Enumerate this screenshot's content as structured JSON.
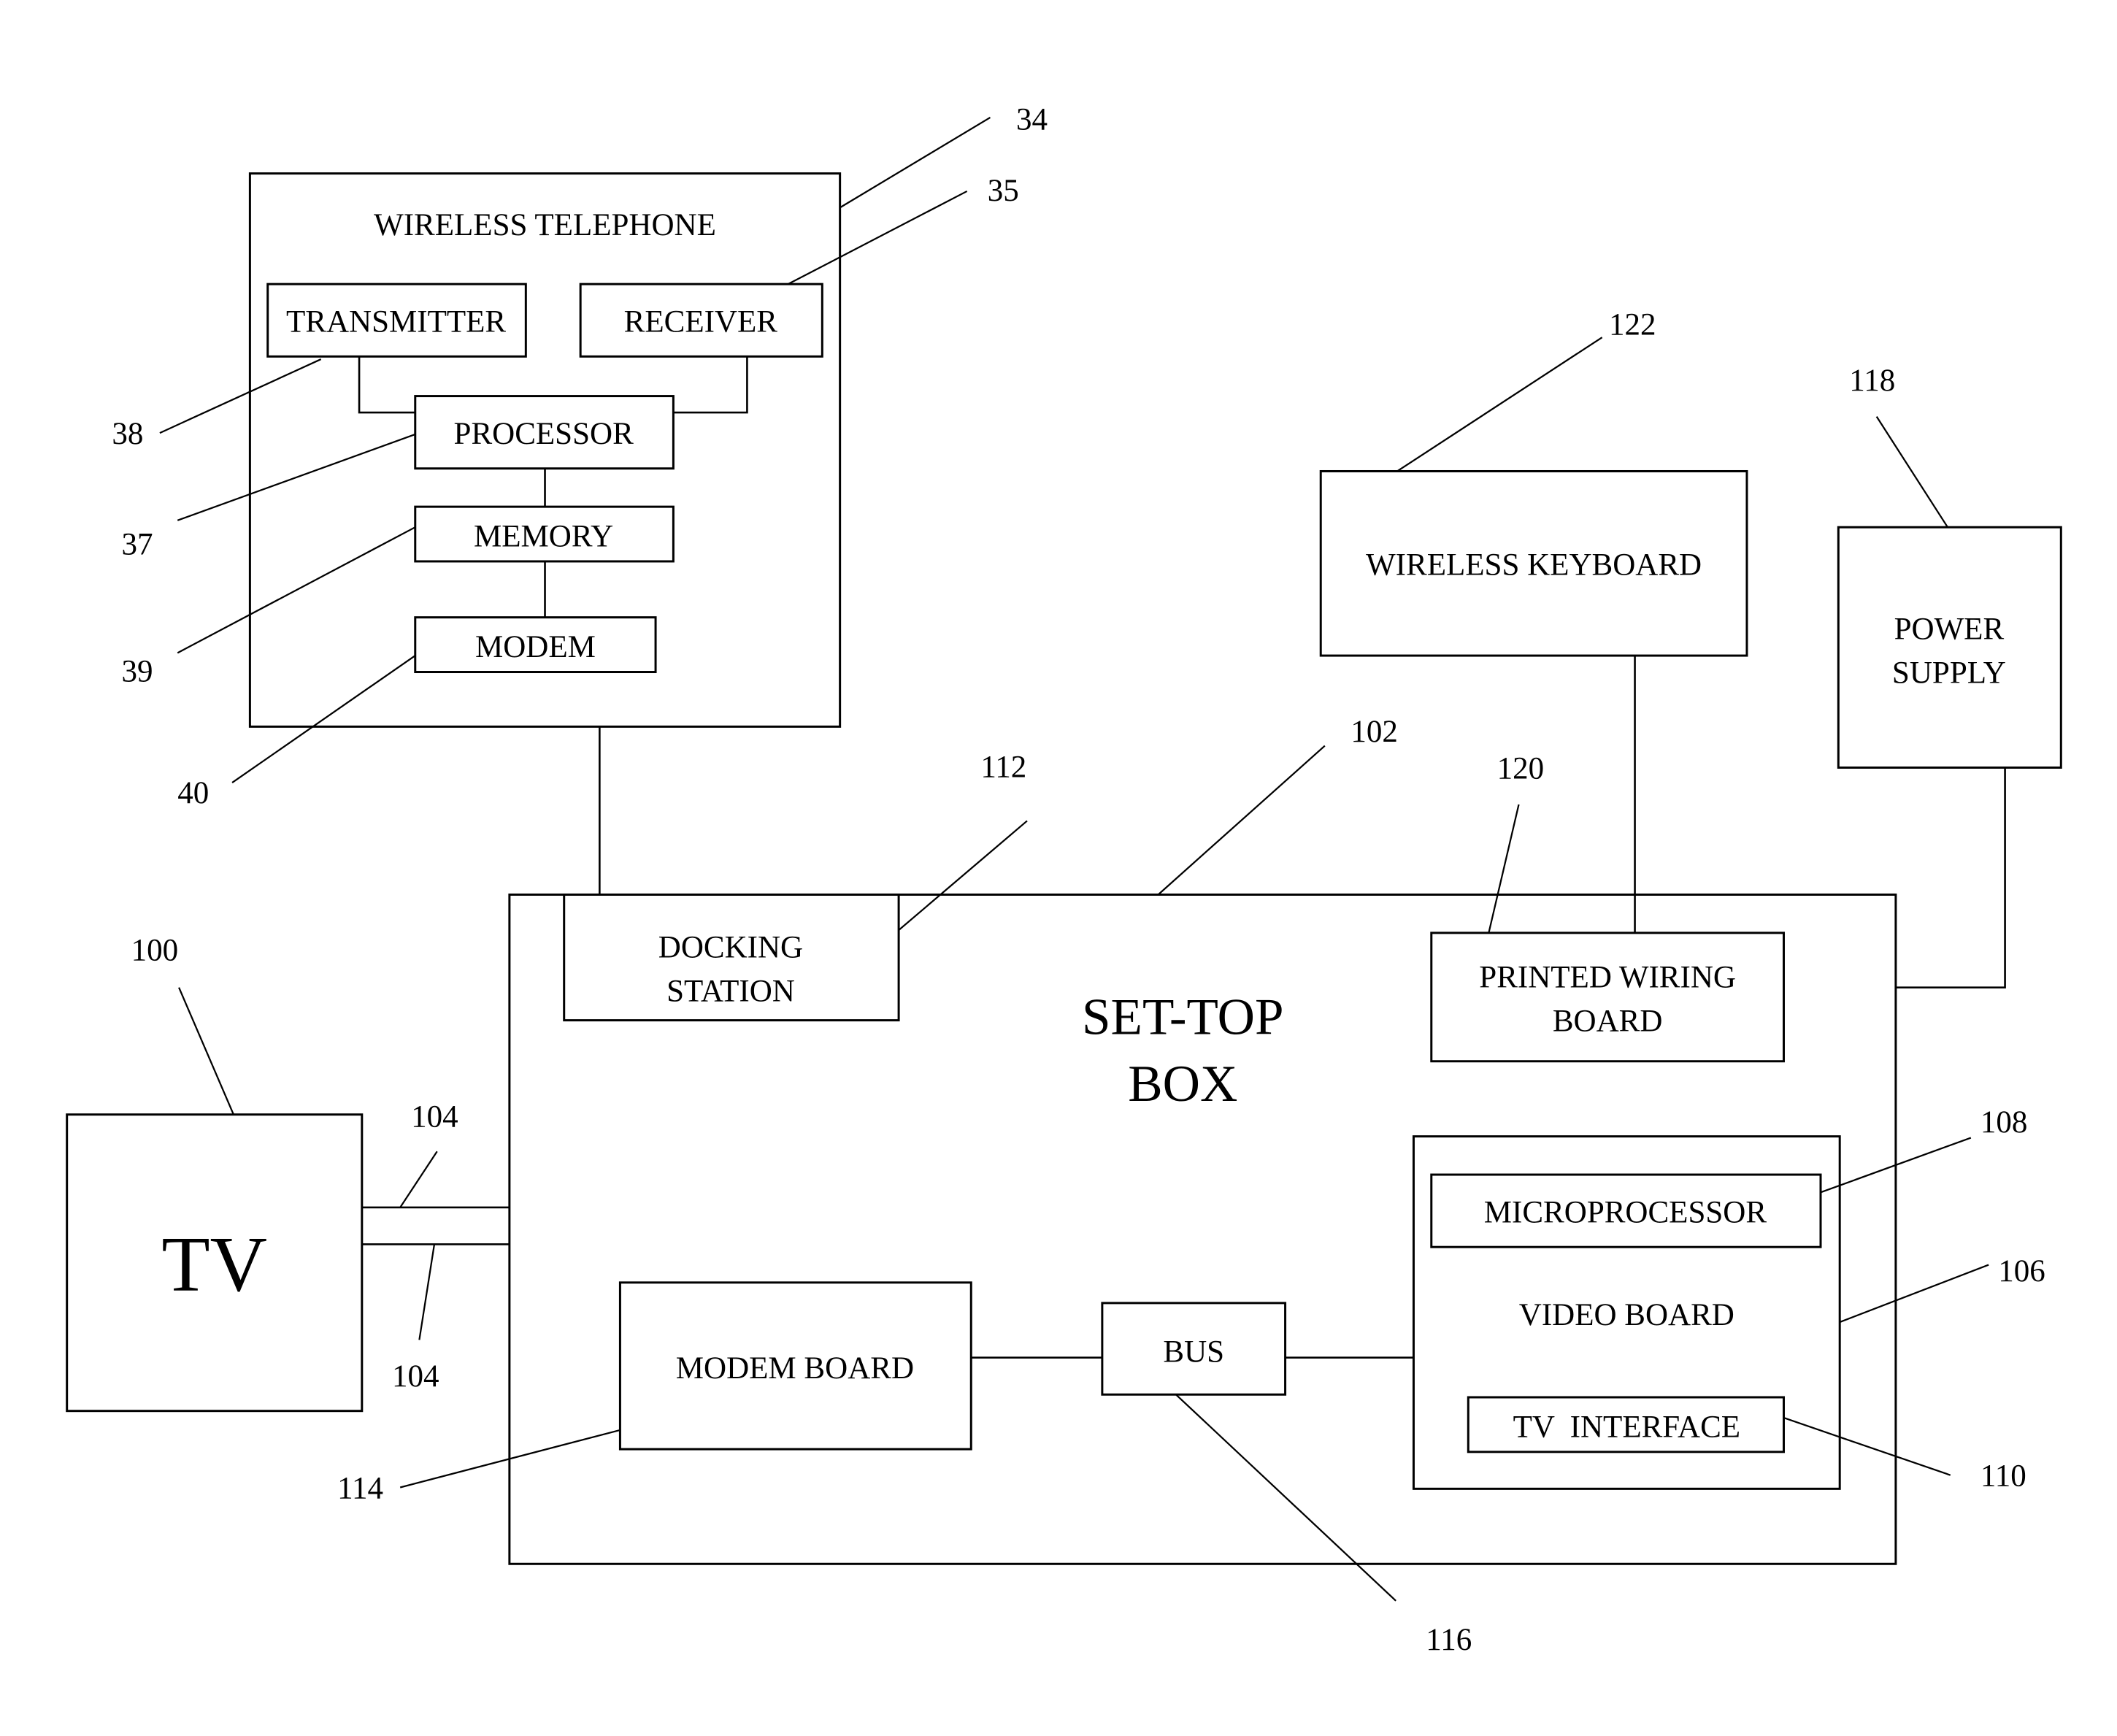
{
  "diagram": {
    "components": {
      "wireless_telephone": {
        "label": "WIRELESS TELEPHONE",
        "ref": "34"
      },
      "transmitter": {
        "label": "TRANSMITTER",
        "ref": "38"
      },
      "receiver": {
        "label": "RECEIVER",
        "ref": "35"
      },
      "processor": {
        "label": "PROCESSOR",
        "ref": "37"
      },
      "memory": {
        "label": "MEMORY",
        "ref": "39"
      },
      "modem": {
        "label": "MODEM",
        "ref": "40"
      },
      "wireless_keyboard": {
        "label": "WIRELESS KEYBOARD",
        "ref": "122"
      },
      "power_supply": {
        "label_line1": "POWER",
        "label_line2": "SUPPLY",
        "ref": "118"
      },
      "set_top_box": {
        "label_line1": "SET-TOP",
        "label_line2": "BOX",
        "ref": "102"
      },
      "docking_station": {
        "label_line1": "DOCKING",
        "label_line2": "STATION",
        "ref": "112"
      },
      "printed_wiring_board": {
        "label_line1": "PRINTED WIRING",
        "label_line2": "BOARD",
        "ref": "120"
      },
      "tv": {
        "label": "TV",
        "ref": "100"
      },
      "tv_connection": {
        "ref_top": "104",
        "ref_bottom": "104"
      },
      "modem_board": {
        "label": "MODEM BOARD",
        "ref": "114"
      },
      "bus": {
        "label": "BUS",
        "ref": "116"
      },
      "video_board": {
        "label": "VIDEO BOARD",
        "ref": "106"
      },
      "microprocessor": {
        "label": "MICROPROCESSOR",
        "ref": "108"
      },
      "tv_interface": {
        "label": "TV  INTERFACE",
        "ref": "110"
      }
    }
  }
}
